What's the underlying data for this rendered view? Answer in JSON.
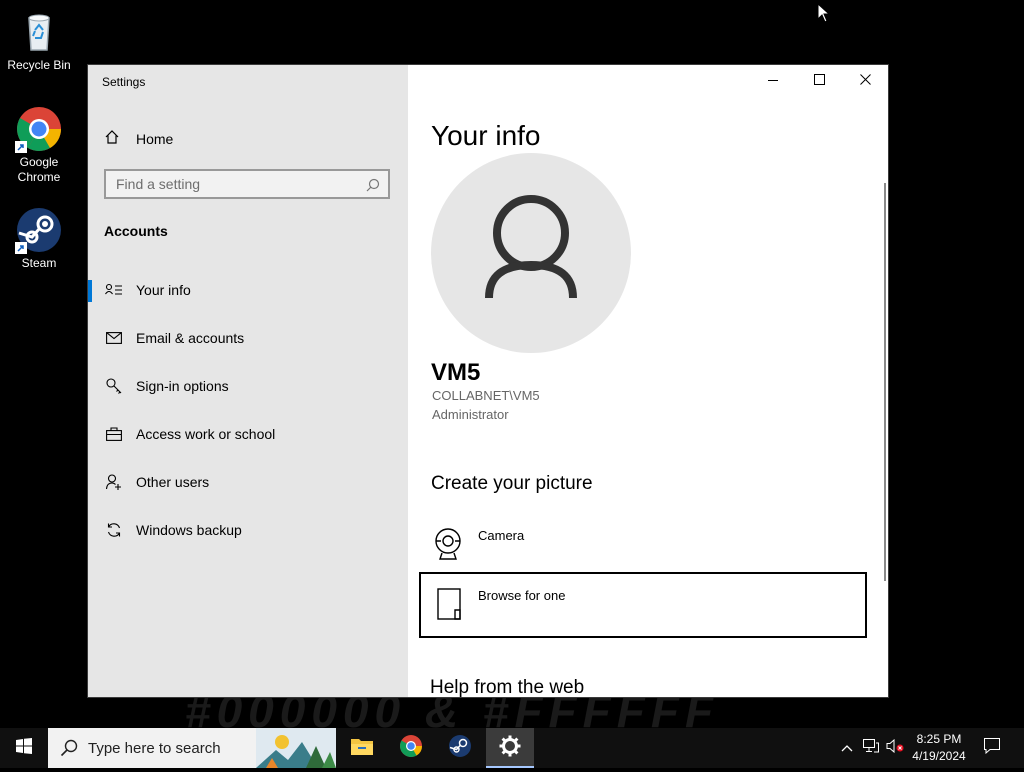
{
  "desktop": {
    "icons": [
      {
        "label": "Recycle Bin"
      },
      {
        "label": "Google Chrome"
      },
      {
        "label": "Steam"
      }
    ],
    "wallpaper_text": "#000000 & #FFFFFF"
  },
  "window": {
    "title": "Settings",
    "controls": {
      "minimize": "minimize-icon",
      "maximize": "maximize-icon",
      "close": "close-icon"
    }
  },
  "sidebar": {
    "home_label": "Home",
    "search_placeholder": "Find a setting",
    "section": "Accounts",
    "items": [
      {
        "label": "Your info",
        "icon": "contact-card-icon",
        "selected": true
      },
      {
        "label": "Email & accounts",
        "icon": "mail-icon"
      },
      {
        "label": "Sign-in options",
        "icon": "key-icon"
      },
      {
        "label": "Access work or school",
        "icon": "briefcase-icon"
      },
      {
        "label": "Other users",
        "icon": "person-add-icon"
      },
      {
        "label": "Windows backup",
        "icon": "sync-icon"
      }
    ]
  },
  "main": {
    "title": "Your info",
    "user": {
      "name": "VM5",
      "account": "COLLABNET\\VM5",
      "role": "Administrator"
    },
    "create_picture": {
      "heading": "Create your picture",
      "options": [
        {
          "label": "Camera",
          "icon": "webcam-icon"
        },
        {
          "label": "Browse for one",
          "icon": "document-icon"
        }
      ]
    },
    "help_heading": "Help from the web"
  },
  "taskbar": {
    "search_placeholder": "Type here to search",
    "apps": [
      "file-explorer",
      "chrome",
      "steam",
      "settings"
    ],
    "clock": {
      "time": "8:25 PM",
      "date": "4/19/2024"
    }
  },
  "colors": {
    "accent": "#0078d7",
    "sidebar_bg": "#e6e6e6",
    "taskbar_bg": "#101010"
  }
}
